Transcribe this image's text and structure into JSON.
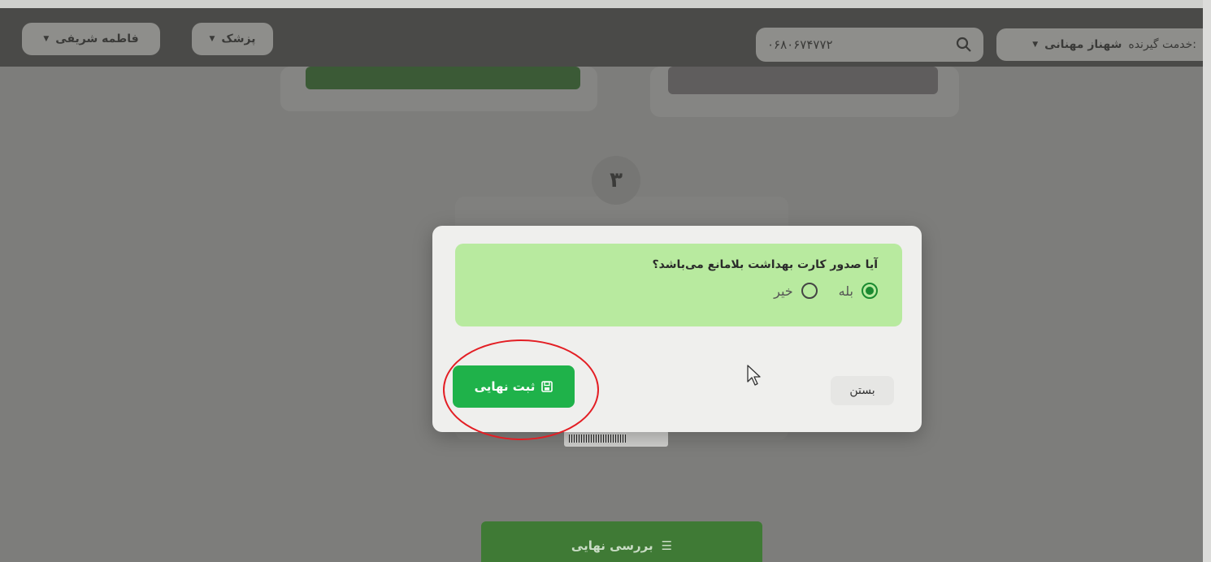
{
  "header": {
    "patient_label": "خدمت گیرنده:",
    "patient_name": "شهناز مهنانی",
    "search_value": "۰۶۸۰۶۷۴۷۷۲",
    "role_label": "پزشک",
    "user_name": "فاطمه شریفی"
  },
  "background": {
    "step_number": "۳",
    "review_button_label": "بررسی نهایی"
  },
  "modal": {
    "question": "آیا صدور کارت بهداشت بلامانع می‌باشد؟",
    "options": [
      {
        "label": "بله",
        "selected": true
      },
      {
        "label": "خیر",
        "selected": false
      }
    ],
    "submit_label": "ثبت نهایی",
    "close_label": "بستن"
  },
  "colors": {
    "submit_green": "#1fb24a",
    "question_bg": "#b8ea9f",
    "highlight_ring": "#e31e24"
  }
}
